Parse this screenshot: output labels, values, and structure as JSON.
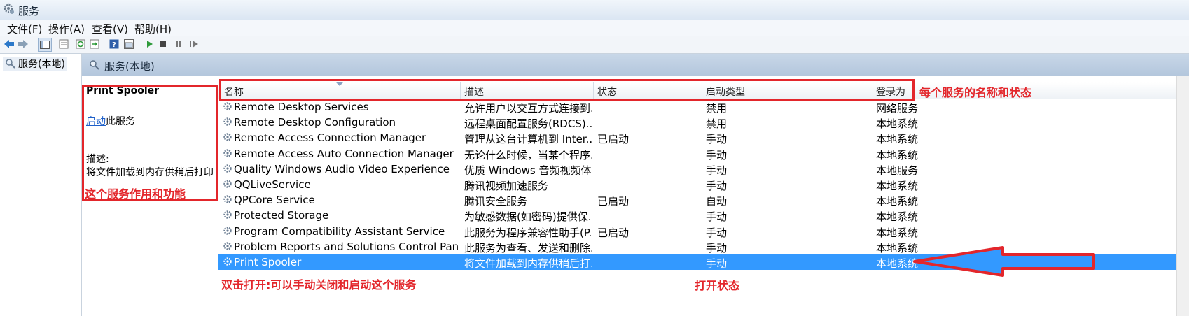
{
  "window": {
    "title": "服务"
  },
  "menu": [
    "文件(F)",
    "操作(A)",
    "查看(V)",
    "帮助(H)"
  ],
  "toolbar": {
    "icons": [
      "back-icon",
      "forward-icon",
      "show-hide-tree-icon",
      "properties-icon",
      "refresh-icon",
      "export-list-icon",
      "help-icon",
      "view-icon",
      "start-icon",
      "stop-icon",
      "pause-icon",
      "resume-icon"
    ]
  },
  "tree": {
    "root_label": "服务(本地)"
  },
  "pane": {
    "title": "服务(本地)"
  },
  "detail": {
    "service_name": "Print Spooler",
    "start_link": "启动",
    "start_suffix": "此服务",
    "description_label": "描述:",
    "description_text": "将文件加载到内存供稍后打印"
  },
  "columns": [
    "名称",
    "描述",
    "状态",
    "启动类型",
    "登录为"
  ],
  "rows": [
    {
      "name": "Remote Desktop Services",
      "desc": "允许用户以交互方式连接到...",
      "status": "",
      "startup": "禁用",
      "logon": "网络服务"
    },
    {
      "name": "Remote Desktop Configuration",
      "desc": "远程桌面配置服务(RDCS)...",
      "status": "",
      "startup": "禁用",
      "logon": "本地系统"
    },
    {
      "name": "Remote Access Connection Manager",
      "desc": "管理从这台计算机到 Inter...",
      "status": "已启动",
      "startup": "手动",
      "logon": "本地系统"
    },
    {
      "name": "Remote Access Auto Connection Manager",
      "desc": "无论什么时候，当某个程序...",
      "status": "",
      "startup": "手动",
      "logon": "本地系统"
    },
    {
      "name": "Quality Windows Audio Video Experience",
      "desc": "优质 Windows 音频视频体...",
      "status": "",
      "startup": "手动",
      "logon": "本地服务"
    },
    {
      "name": "QQLiveService",
      "desc": "腾讯视频加速服务",
      "status": "",
      "startup": "手动",
      "logon": "本地系统"
    },
    {
      "name": "QPCore Service",
      "desc": "腾讯安全服务",
      "status": "已启动",
      "startup": "自动",
      "logon": "本地系统"
    },
    {
      "name": "Protected Storage",
      "desc": "为敏感数据(如密码)提供保...",
      "status": "",
      "startup": "手动",
      "logon": "本地系统"
    },
    {
      "name": "Program Compatibility Assistant Service",
      "desc": "此服务为程序兼容性助手(P...",
      "status": "已启动",
      "startup": "手动",
      "logon": "本地系统"
    },
    {
      "name": "Problem Reports and Solutions Control Panel ...",
      "desc": "此服务为查看、发送和删除...",
      "status": "",
      "startup": "手动",
      "logon": "本地系统"
    },
    {
      "name": "Print Spooler",
      "desc": "将文件加载到内存供稍后打...",
      "status": "",
      "startup": "手动",
      "logon": "本地系统",
      "selected": true
    }
  ],
  "annotations": {
    "header_note": "每个服务的名称和状态",
    "detail_note": "这个服务作用和功能",
    "dblclick_note": "双击打开:可以手动关闭和启动这个服务",
    "open_state_note": "打开状态"
  },
  "colors": {
    "annotation": "#e3262b",
    "selection": "#3399ff",
    "arrow_fill": "#3399ff"
  }
}
